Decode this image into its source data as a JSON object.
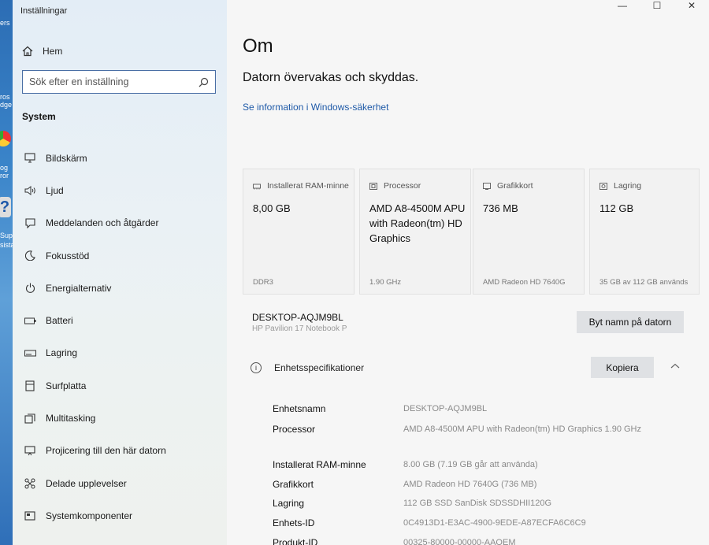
{
  "desktop": {
    "fragments": [
      "ers",
      "ros",
      "dge",
      "og",
      "ror",
      "Sup",
      "sista"
    ]
  },
  "app": {
    "title": "Inställningar",
    "window_controls": {
      "minimize": "—",
      "maximize": "☐",
      "close": "✕"
    }
  },
  "sidebar": {
    "home_label": "Hem",
    "search_placeholder": "Sök efter en inställning",
    "section_title": "System",
    "items": [
      {
        "label": "Bildskärm",
        "icon": "monitor-icon"
      },
      {
        "label": "Ljud",
        "icon": "speaker-icon"
      },
      {
        "label": "Meddelanden och åtgärder",
        "icon": "notification-icon"
      },
      {
        "label": "Fokusstöd",
        "icon": "moon-icon"
      },
      {
        "label": "Energialternativ",
        "icon": "power-icon"
      },
      {
        "label": "Batteri",
        "icon": "battery-icon"
      },
      {
        "label": "Lagring",
        "icon": "storage-icon"
      },
      {
        "label": "Surfplatta",
        "icon": "tablet-icon"
      },
      {
        "label": "Multitasking",
        "icon": "multitasking-icon"
      },
      {
        "label": "Projicering till den här datorn",
        "icon": "projecting-icon"
      },
      {
        "label": "Delade upplevelser",
        "icon": "shared-icon"
      },
      {
        "label": "Systemkomponenter",
        "icon": "components-icon"
      }
    ]
  },
  "main": {
    "title": "Om",
    "protection_status": "Datorn övervakas och skyddas.",
    "security_link": "Se information i Windows-säkerhet",
    "cards": [
      {
        "label": "Installerat RAM-minne",
        "value": "8,00 GB",
        "detail": "DDR3",
        "icon": "ram-icon"
      },
      {
        "label": "Processor",
        "value": "AMD A8-4500M APU with Radeon(tm) HD Graphics",
        "detail": "1.90 GHz",
        "icon": "cpu-icon"
      },
      {
        "label": "Grafikkort",
        "value": "736 MB",
        "detail": "AMD Radeon HD 7640G",
        "icon": "gpu-icon"
      },
      {
        "label": "Lagring",
        "value": "112 GB",
        "detail": "35 GB av 112 GB används",
        "icon": "disk-icon"
      }
    ],
    "device_name": "DESKTOP-AQJM9BL",
    "device_model": "HP Pavilion 17 Notebook P",
    "rename_button": "Byt namn på datorn",
    "specs_title": "Enhetsspecifikationer",
    "copy_button": "Kopiera",
    "specs": [
      {
        "key": "Enhetsnamn",
        "value": "DESKTOP-AQJM9BL"
      },
      {
        "key": "Processor",
        "value": "AMD A8-4500M APU with Radeon(tm) HD Graphics 1.90 GHz"
      },
      {
        "key": "Installerat RAM-minne",
        "value": "8.00 GB (7.19 GB går att använda)"
      },
      {
        "key": "Grafikkort",
        "value": "AMD Radeon HD 7640G (736 MB)"
      },
      {
        "key": "Lagring",
        "value": "112 GB SSD SanDisk SDSSDHII120G"
      },
      {
        "key": "Enhets-ID",
        "value": "0C4913D1-E3AC-4900-9EDE-A87ECFA6C6C9"
      },
      {
        "key": "Produkt-ID",
        "value": "00325-80000-00000-AAOEM"
      }
    ]
  }
}
